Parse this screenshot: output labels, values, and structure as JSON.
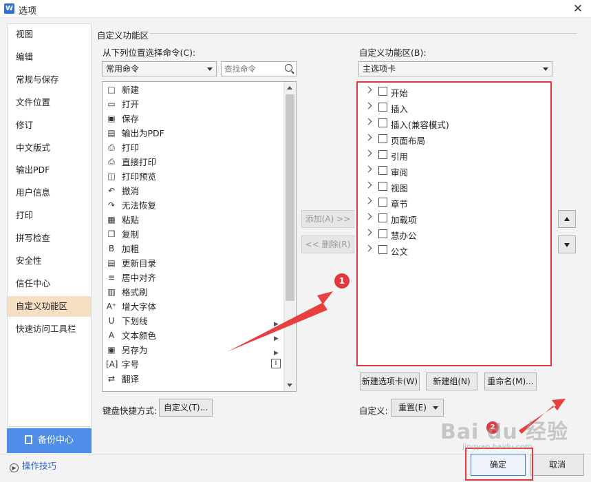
{
  "window": {
    "title": "选项",
    "app_icon": "W"
  },
  "nav": {
    "items": [
      "视图",
      "编辑",
      "常规与保存",
      "文件位置",
      "修订",
      "中文版式",
      "输出PDF",
      "用户信息",
      "打印",
      "拼写检查",
      "安全性",
      "信任中心",
      "自定义功能区",
      "快速访问工具栏"
    ],
    "active": "自定义功能区",
    "backup_label": "备份中心",
    "tips_label": "操作技巧"
  },
  "section_title": "自定义功能区",
  "left_panel": {
    "label": "从下列位置选择命令(C):",
    "combo_value": "常用命令",
    "search_placeholder": "查找命令",
    "commands": [
      {
        "label": "新建",
        "icon": "□"
      },
      {
        "label": "打开",
        "icon": "▭"
      },
      {
        "label": "保存",
        "icon": "▣"
      },
      {
        "label": "输出为PDF",
        "icon": "▤"
      },
      {
        "label": "打印",
        "icon": "⎙"
      },
      {
        "label": "直接打印",
        "icon": "⎙"
      },
      {
        "label": "打印预览",
        "icon": "◫"
      },
      {
        "label": "撤消",
        "icon": "↶"
      },
      {
        "label": "无法恢复",
        "icon": "↷"
      },
      {
        "label": "粘贴",
        "icon": "▦"
      },
      {
        "label": "复制",
        "icon": "❐"
      },
      {
        "label": "加粗",
        "icon": "B"
      },
      {
        "label": "更新目录",
        "icon": "▤"
      },
      {
        "label": "居中对齐",
        "icon": "≡"
      },
      {
        "label": "格式刷",
        "icon": "▥"
      },
      {
        "label": "增大字体",
        "icon": "A⁺"
      },
      {
        "label": "下划线",
        "icon": "U"
      },
      {
        "label": "文本颜色",
        "icon": "A"
      },
      {
        "label": "另存为",
        "icon": "▣"
      },
      {
        "label": "字号",
        "icon": "⁅A⁆"
      },
      {
        "label": "翻译",
        "icon": "⇄"
      }
    ],
    "shortcut_label": "键盘快捷方式:",
    "shortcut_button": "自定义(T)..."
  },
  "middle": {
    "add_label": "添加(A) >>",
    "remove_label": "<< 删除(R)"
  },
  "right_panel": {
    "label": "自定义功能区(B):",
    "combo_value": "主选项卡",
    "tabs": [
      "开始",
      "插入",
      "插入(兼容模式)",
      "页面布局",
      "引用",
      "审阅",
      "视图",
      "章节",
      "加载项",
      "慧办公",
      "公文"
    ],
    "new_tab_button": "新建选项卡(W)",
    "new_group_button": "新建组(N)",
    "rename_button": "重命名(M)...",
    "customize_label": "自定义:",
    "reset_button": "重置(E)"
  },
  "footer": {
    "ok_label": "确定",
    "cancel_label": "取消"
  },
  "annotations": {
    "step1": "1",
    "step2": "2",
    "watermark": "Bai du 经验",
    "watermark_sub": "jingyan.baidu.com"
  },
  "colors": {
    "accent": "#4f8ee8",
    "nav_active": "#f6dfc3",
    "highlight": "#e03a3e"
  }
}
